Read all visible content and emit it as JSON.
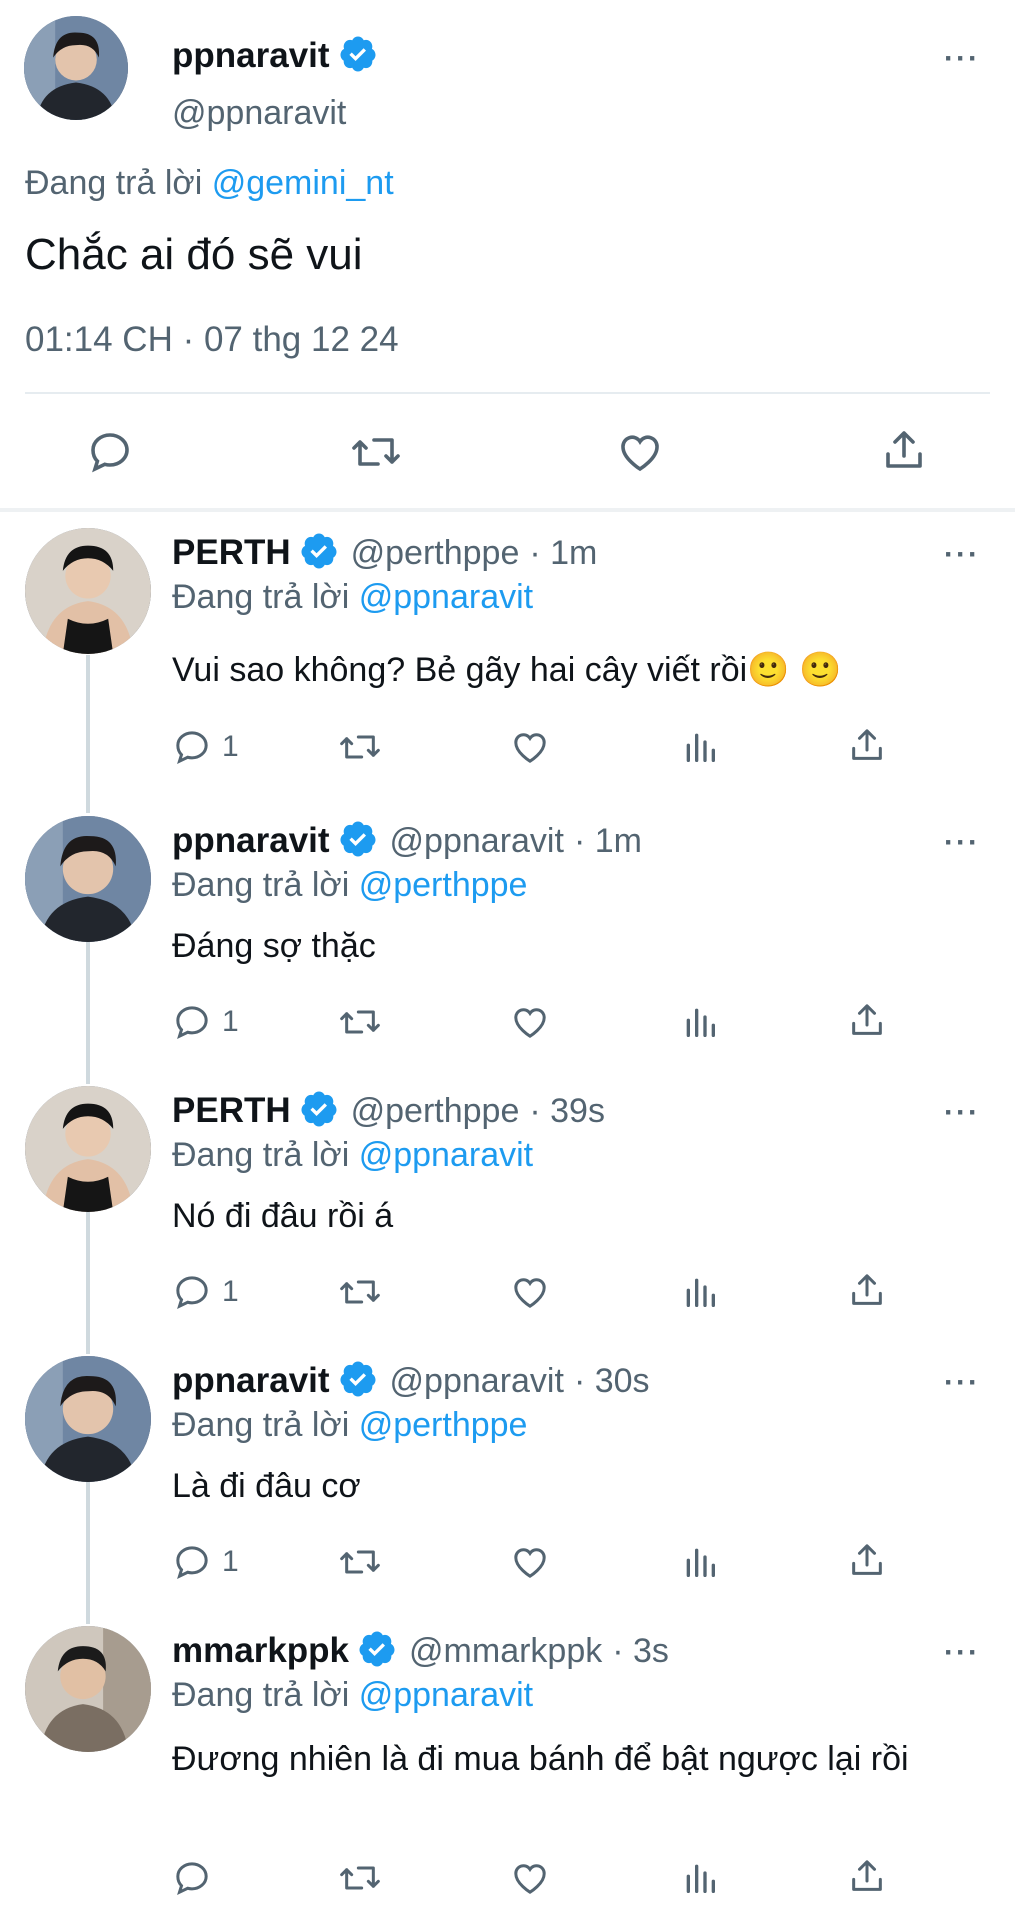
{
  "main_tweet": {
    "display_name": "ppnaravit",
    "handle": "@ppnaravit",
    "reply_prefix": "Đang trả lời",
    "reply_mention": "@gemini_nt",
    "text": "Chắc ai đó sẽ vui",
    "timestamp": "01:14 CH · 07 thg 12 24",
    "more": "···"
  },
  "replies": [
    {
      "display_name": "PERTH",
      "handle": "@perthppe",
      "time": "· 1m",
      "reply_prefix": "Đang trả lời",
      "reply_mention": "@ppnaravit",
      "text": "Vui sao không? Bẻ gãy hai cây viết rồi🙂 🙂",
      "reply_count": "1",
      "more": "···"
    },
    {
      "display_name": "ppnaravit",
      "handle": "@ppnaravit",
      "time": "· 1m",
      "reply_prefix": "Đang trả lời",
      "reply_mention": "@perthppe",
      "text": "Đáng sợ thặc",
      "reply_count": "1",
      "more": "···"
    },
    {
      "display_name": "PERTH",
      "handle": "@perthppe",
      "time": "· 39s",
      "reply_prefix": "Đang trả lời",
      "reply_mention": "@ppnaravit",
      "text": "Nó đi đâu rồi á",
      "reply_count": "1",
      "more": "···"
    },
    {
      "display_name": "ppnaravit",
      "handle": "@ppnaravit",
      "time": "· 30s",
      "reply_prefix": "Đang trả lời",
      "reply_mention": "@perthppe",
      "text": "Là đi đâu cơ",
      "reply_count": "1",
      "more": "···"
    },
    {
      "display_name": "mmarkppk",
      "handle": "@mmarkppk",
      "time": "· 3s",
      "reply_prefix": "Đang trả lời",
      "reply_mention": "@ppnaravit",
      "text": "Đương nhiên là đi mua bánh để bật ngược lại rồi",
      "reply_count": "",
      "more": "···"
    }
  ],
  "icons": {
    "reply": "speech-bubble-icon",
    "retweet": "retweet-icon",
    "like": "heart-icon",
    "views": "bar-chart-icon",
    "share": "share-icon",
    "verified": "verified-badge-icon"
  },
  "colors": {
    "accent": "#1d9bf0",
    "text": "#0f1419",
    "secondary": "#536471",
    "thread_line": "#cfd9de"
  }
}
